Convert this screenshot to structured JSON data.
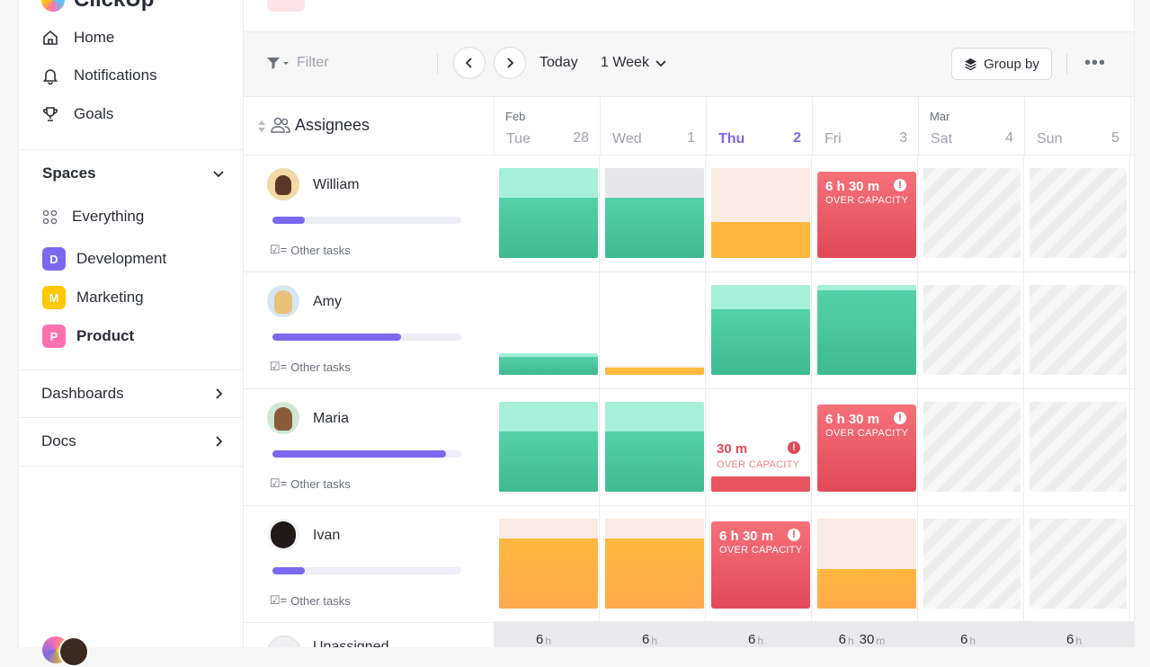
{
  "brand": {
    "name": "ClickUp"
  },
  "sidebar": {
    "nav": [
      {
        "label": "Home",
        "icon": "home-icon"
      },
      {
        "label": "Notifications",
        "icon": "bell-icon"
      },
      {
        "label": "Goals",
        "icon": "trophy-icon"
      }
    ],
    "spaces_title": "Spaces",
    "everything_label": "Everything",
    "spaces": [
      {
        "letter": "D",
        "label": "Development",
        "color": "#7b68ee"
      },
      {
        "letter": "M",
        "label": "Marketing",
        "color": "#ffc800"
      },
      {
        "letter": "P",
        "label": "Product",
        "color": "#fd71af"
      }
    ],
    "dashboards_label": "Dashboards",
    "docs_label": "Docs"
  },
  "toolbar": {
    "filter_label": "Filter",
    "today_label": "Today",
    "range_label": "1 Week",
    "group_by_label": "Group by"
  },
  "calendar": {
    "assignees_label": "Assignees",
    "days": [
      {
        "month": "Feb",
        "name": "Tue",
        "num": "28",
        "today": false
      },
      {
        "month": "",
        "name": "Wed",
        "num": "1",
        "today": false
      },
      {
        "month": "",
        "name": "Thu",
        "num": "2",
        "today": true
      },
      {
        "month": "",
        "name": "Fri",
        "num": "3",
        "today": false
      },
      {
        "month": "Mar",
        "name": "Sat",
        "num": "4",
        "today": false
      },
      {
        "month": "",
        "name": "Sun",
        "num": "5",
        "today": false
      }
    ],
    "other_tasks_label": "Other tasks",
    "over_capacity_label": "OVER CAPACITY",
    "people": [
      {
        "name": "William",
        "progress": 0.17
      },
      {
        "name": "Amy",
        "progress": 0.68
      },
      {
        "name": "Maria",
        "progress": 0.92
      },
      {
        "name": "Ivan",
        "progress": 0.17
      }
    ],
    "partial_person": "Unassigned",
    "overloads": [
      {
        "h": "6",
        "m": "30"
      },
      {
        "h": "",
        "m": "30"
      },
      {
        "h": "6",
        "m": "30"
      },
      {
        "h": "6",
        "m": "30"
      }
    ],
    "totals": [
      {
        "h": "6",
        "m": ""
      },
      {
        "h": "6",
        "m": ""
      },
      {
        "h": "6",
        "m": ""
      },
      {
        "h": "6",
        "m": "30"
      },
      {
        "h": "6",
        "m": ""
      },
      {
        "h": "6",
        "m": ""
      }
    ],
    "colors": {
      "green": "#4fcca0",
      "green_light": "#a6f0da",
      "orange": "#ffae42",
      "orange_light": "#f9ebe4",
      "red": "#e85561",
      "accent": "#7b68ee"
    }
  }
}
